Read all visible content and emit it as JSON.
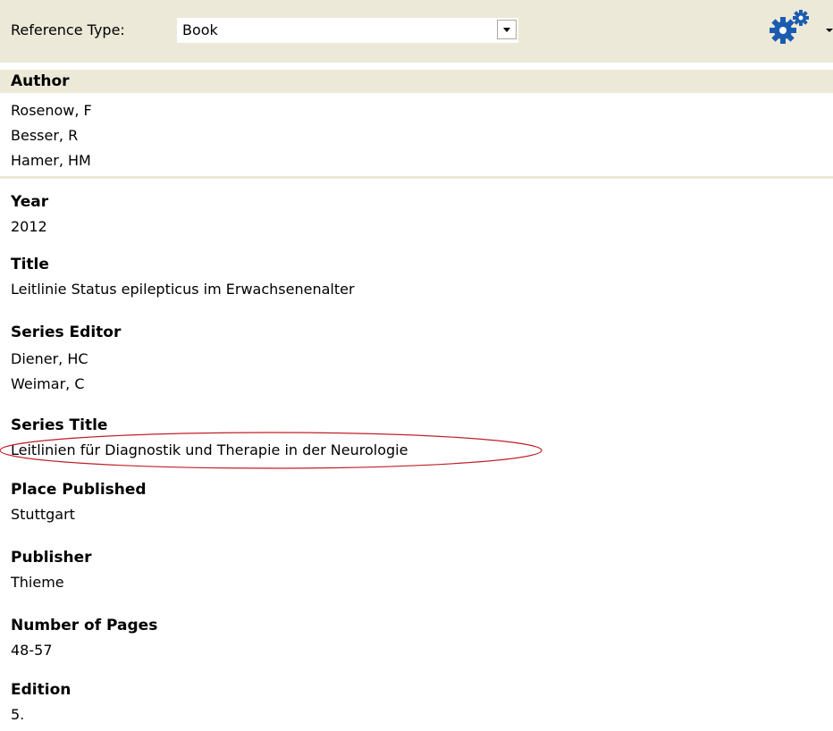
{
  "toolbar": {
    "reference_type_label": "Reference Type:",
    "reference_type_value": "Book",
    "options_icon": "gears-icon"
  },
  "author": {
    "label": "Author",
    "names": [
      "Rosenow, F",
      "Besser, R",
      "Hamer, HM"
    ]
  },
  "fields": {
    "year": {
      "label": "Year",
      "value": "2012"
    },
    "title": {
      "label": "Title",
      "value": "Leitlinie Status epilepticus im Erwachsenenalter"
    },
    "series_editor": {
      "label": "Series Editor",
      "values": [
        "Diener, HC",
        "Weimar, C"
      ]
    },
    "series_title": {
      "label": "Series Title",
      "value": "Leitlinien für Diagnostik und Therapie in der Neurologie"
    },
    "place_published": {
      "label": "Place Published",
      "value": "Stuttgart"
    },
    "publisher": {
      "label": "Publisher",
      "value": "Thieme"
    },
    "number_of_pages": {
      "label": "Number of Pages",
      "value": "48-57"
    },
    "edition": {
      "label": "Edition",
      "value": "5."
    }
  },
  "colors": {
    "panel_background": "#ece9d8",
    "gear_blue": "#1c5cb0",
    "highlight_red": "#c0202a"
  }
}
